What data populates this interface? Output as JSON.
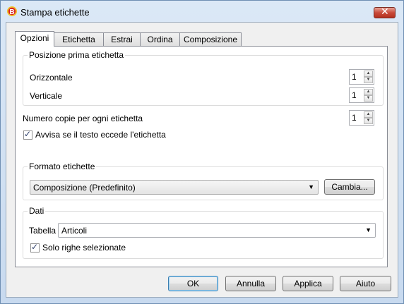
{
  "window": {
    "title": "Stampa etichette",
    "close_symbol": "✕"
  },
  "tabs": [
    {
      "label": "Opzioni",
      "active": true
    },
    {
      "label": "Etichetta",
      "active": false
    },
    {
      "label": "Estrai",
      "active": false
    },
    {
      "label": "Ordina",
      "active": false
    },
    {
      "label": "Composizione",
      "active": false
    }
  ],
  "position_group": {
    "title": "Posizione prima etichetta",
    "horizontal": {
      "label": "Orizzontale",
      "value": "1"
    },
    "vertical": {
      "label": "Verticale",
      "value": "1"
    }
  },
  "copies": {
    "label": "Numero copie per ogni etichetta",
    "value": "1"
  },
  "warn_overflow": {
    "label": "Avvisa se il testo eccede l'etichetta",
    "checked": true
  },
  "format_group": {
    "title": "Formato etichette",
    "selected": "Composizione (Predefinito)",
    "change_button": "Cambia..."
  },
  "data_group": {
    "title": "Dati",
    "table_label": "Tabella",
    "table_selected": "Articoli",
    "selected_rows": {
      "label": "Solo righe selezionate",
      "checked": true
    }
  },
  "footer": {
    "ok": "OK",
    "cancel": "Annulla",
    "apply": "Applica",
    "help": "Aiuto"
  },
  "colors": {
    "titlebar": "#dbe8f6",
    "close_button": "#c94a3a",
    "panel": "#ffffff",
    "dialog": "#f0f0f0"
  }
}
